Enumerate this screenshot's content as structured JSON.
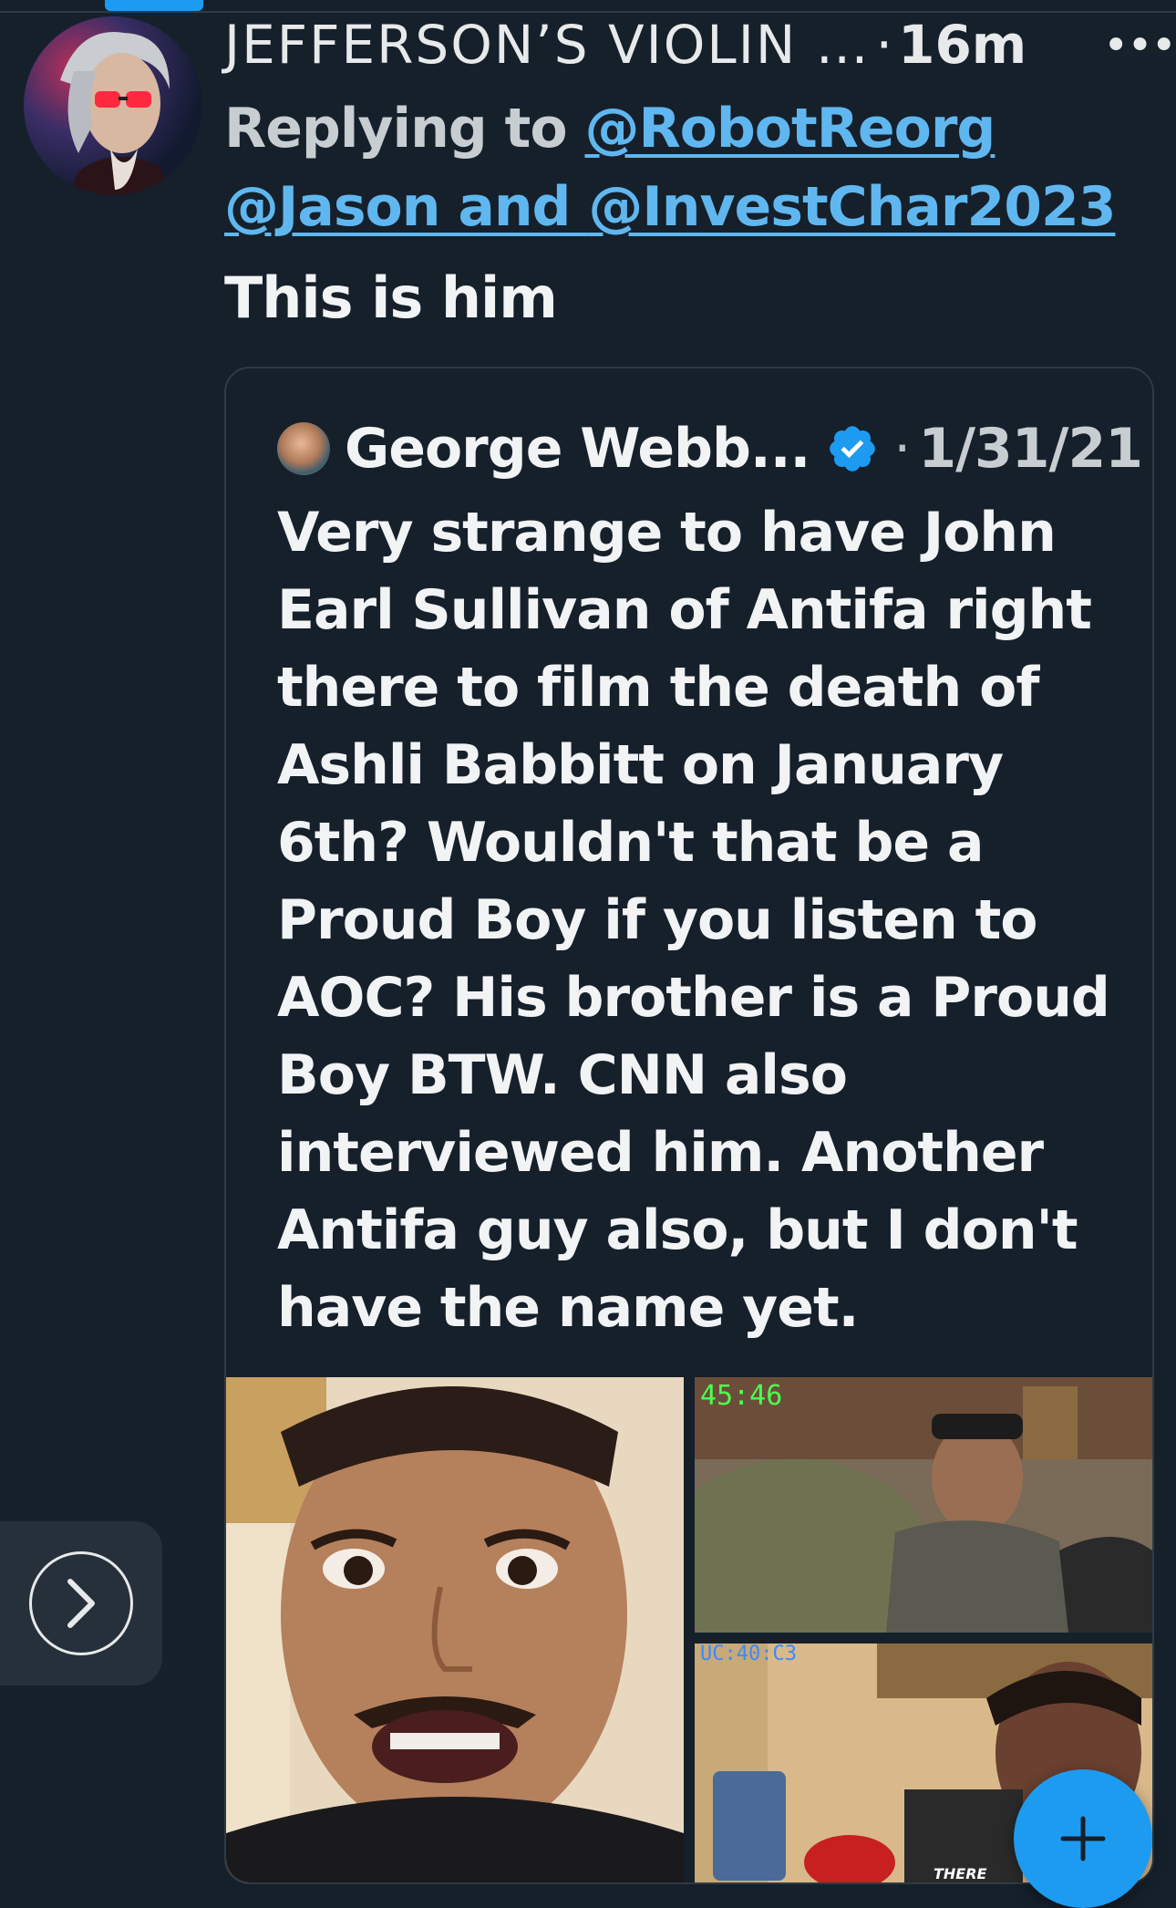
{
  "tweet": {
    "display_name": "JEFFERSON’S VIOLIN …",
    "separator": "·",
    "time": "16m",
    "more_icon": "more-horizontal-icon",
    "replying_prefix": "Replying to ",
    "reply_to_1": "@RobotReorg",
    "reply_to_2": "@Jason",
    "reply_and": " and ",
    "reply_to_3": "@InvestChar2023",
    "text": "This is him"
  },
  "quote": {
    "author": "George Webb...",
    "separator": "·",
    "date": "1/31/21",
    "verified_icon": "verified-badge-icon",
    "lines": [
      "Very strange to have John",
      "Earl Sullivan of Antifa right",
      "there to film the death of",
      "Ashli Babbitt on January",
      "6th?  Wouldn't that be a",
      "Proud Boy if you listen to",
      "AOC?  His brother is a Proud",
      "Boy BTW.  CNN also",
      "interviewed him. Another",
      "Antifa guy also, but I don't",
      "have the name yet."
    ],
    "media": {
      "overlay_1": "45:46",
      "overlay_2": "UC:40:C3",
      "overlay_3": "THERE"
    }
  },
  "controls": {
    "next_icon": "chevron-right-icon",
    "compose_icon": "plus-icon"
  },
  "colors": {
    "background": "#15202b",
    "accent": "#1d9bf0",
    "link": "#60b7ef"
  }
}
